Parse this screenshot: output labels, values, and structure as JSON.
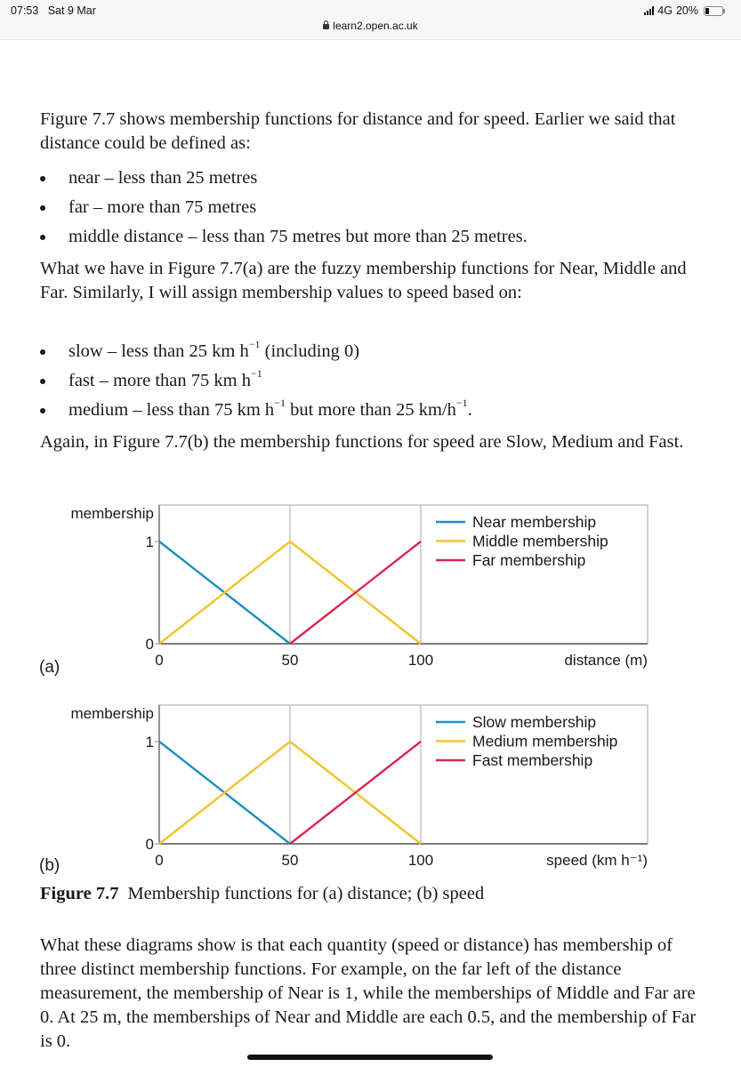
{
  "status_bar": {
    "time": "07:53",
    "date": "Sat 9 Mar",
    "network": "4G",
    "battery": "20%",
    "battery_level": 0.2,
    "url": "learn2.open.ac.uk",
    "icons": [
      "signal-icon",
      "battery-icon",
      "lock-icon"
    ]
  },
  "content": {
    "intro": "Figure 7.7 shows membership functions for distance and for speed. Earlier we said that distance could be defined as:",
    "distance_bullets": [
      "near – less than 25 metres",
      "far – more than 75 metres",
      "middle distance – less than 75 metres but more than 25 metres."
    ],
    "para2": "What we have in Figure 7.7(a) are the fuzzy membership functions for Near, Middle and Far. Similarly, I will assign membership values to speed based on:",
    "speed_bullets": [
      {
        "pre": "slow – less than 25 km h",
        "sup1": "−1",
        "mid": " (including 0)",
        "sup2": "",
        "post": ""
      },
      {
        "pre": "fast – more than 75 km h",
        "sup1": "−1",
        "mid": "",
        "sup2": "",
        "post": ""
      },
      {
        "pre": "medium – less than 75 km h",
        "sup1": "−1",
        "mid": " but more than 25 km/h",
        "sup2": "−1",
        "post": "."
      }
    ],
    "para3": "Again, in Figure 7.7(b) the membership functions for speed are Slow, Medium and Fast.",
    "caption_label": "Figure 7.7",
    "caption_text": "Membership functions for (a) distance; (b) speed",
    "para4": "What these diagrams show is that each quantity (speed or distance) has membership of three distinct membership functions. For example, on the far left of the distance measurement, the membership of Near is 1, while the memberships of Middle and Far are 0. At 25 m, the memberships of Near and Middle are each 0.5, and the membership of Far is 0."
  },
  "chart_data": [
    {
      "type": "line",
      "panel": "(a)",
      "title": "",
      "xlabel": "distance (m)",
      "ylabel": "membership",
      "x_ticks": [
        0,
        50,
        100
      ],
      "y_ticks": [
        0,
        1
      ],
      "xlim": [
        0,
        187
      ],
      "ylim": [
        0,
        1.35
      ],
      "grid": "vertical",
      "legend_position": "top-right",
      "series": [
        {
          "name": "Near membership",
          "color": "#1f8fc0",
          "points": [
            [
              0,
              1
            ],
            [
              50,
              0
            ]
          ]
        },
        {
          "name": "Middle membership",
          "color": "#f0c52e",
          "points": [
            [
              0,
              0
            ],
            [
              50,
              1
            ],
            [
              100,
              0
            ]
          ]
        },
        {
          "name": "Far membership",
          "color": "#d9284f",
          "points": [
            [
              50,
              0
            ],
            [
              100,
              1
            ]
          ]
        }
      ]
    },
    {
      "type": "line",
      "panel": "(b)",
      "title": "",
      "xlabel": "speed (km h⁻¹)",
      "ylabel": "membership",
      "x_ticks": [
        0,
        50,
        100
      ],
      "y_ticks": [
        0,
        1
      ],
      "xlim": [
        0,
        187
      ],
      "ylim": [
        0,
        1.35
      ],
      "grid": "vertical",
      "legend_position": "top-right",
      "series": [
        {
          "name": "Slow membership",
          "color": "#1f8fc0",
          "points": [
            [
              0,
              1
            ],
            [
              50,
              0
            ]
          ]
        },
        {
          "name": "Medium membership",
          "color": "#f0c52e",
          "points": [
            [
              0,
              0
            ],
            [
              50,
              1
            ],
            [
              100,
              0
            ]
          ]
        },
        {
          "name": "Fast membership",
          "color": "#d9284f",
          "points": [
            [
              50,
              0
            ],
            [
              100,
              1
            ]
          ]
        }
      ]
    }
  ]
}
